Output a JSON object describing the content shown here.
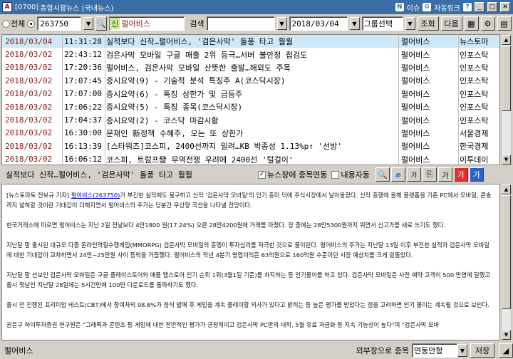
{
  "window": {
    "code": "[0700]",
    "title": "종합시황뉴스 (국내뉴스)",
    "icon_letter": "A",
    "right_items": [
      "N",
      "이슈",
      "자동링크",
      "?"
    ],
    "window_buttons": [
      "_",
      "□",
      "✕"
    ]
  },
  "toolbar": {
    "radio_all": "전체",
    "radio_single_selected": true,
    "stock_code": "263750",
    "stock_tag": "신",
    "stock_name": "펄어비스",
    "search_label": "검색",
    "search_value": "",
    "date": "2018/03/04",
    "group_select": "그룹선택",
    "btn_query": "조회",
    "btn_next": "다음",
    "icons": [
      "screen-icon",
      "gear-icon",
      "save-icon"
    ]
  },
  "news": [
    {
      "date": "2018/03/04",
      "time": "11:31:28",
      "headline": "실적보다 신작…펄어비스, '검은사막' 돌풍 타고 훨훨",
      "stock": "펄어비스",
      "source": "뉴스토마",
      "selected": true
    },
    {
      "date": "2018/03/02",
      "time": "22:43:12",
      "headline": "검은사막 모바일 구글 매출 2위 등극…서버 불안정 접검도",
      "stock": "펄어비스",
      "source": "인포스탁",
      "selected": false
    },
    {
      "date": "2018/03/02",
      "time": "17:20:36",
      "headline": "펄어비스, 검은사막 모바일 산뜻한 출발…해외도 주목",
      "stock": "펄어비스",
      "source": "인포스탁",
      "selected": false
    },
    {
      "date": "2018/03/02",
      "time": "17:07:45",
      "headline": "증시요약(9) - 기술적 분석 특징주 A(코스닥시장)",
      "stock": "펄어비스",
      "source": "인포스탁",
      "selected": false
    },
    {
      "date": "2018/03/02",
      "time": "17:07:00",
      "headline": "증시요약(6) - 특징 상한가 및 급등주",
      "stock": "펄어비스",
      "source": "인포스탁",
      "selected": false
    },
    {
      "date": "2018/03/02",
      "time": "17:06:22",
      "headline": "증시요약(5) - 특징 종목(코스닥시장)",
      "stock": "펄어비스",
      "source": "인포스탁",
      "selected": false
    },
    {
      "date": "2018/03/02",
      "time": "17:04:37",
      "headline": "증시요약(2) - 코스닥 마감시황",
      "stock": "펄어비스",
      "source": "인포스탁",
      "selected": false
    },
    {
      "date": "2018/03/02",
      "time": "16:30:00",
      "headline": "문재인 新정책 수혜주, 오는 또 상한가",
      "stock": "펄어비스",
      "source": "서울경제",
      "selected": false
    },
    {
      "date": "2018/03/02",
      "time": "16:13:39",
      "headline": "[스타워즈]코스피, 2400선까지 밀려…KB 박종성 1.13%p↑ '선방'",
      "stock": "펄어비스",
      "source": "한국경제",
      "selected": false
    },
    {
      "date": "2018/03/02",
      "time": "16:06:12",
      "headline": "코스피, 트럼프發 무역전쟁 우려에 2400선 '털걸이'",
      "stock": "펄어비스",
      "source": "이투데이",
      "selected": false
    }
  ],
  "detail": {
    "title": "실적보다 신작…펄어비스, '검은사막' 돌풍 타고 훨훨",
    "cb_popup": "뉴스창에 종목연동",
    "cb_popup_checked": true,
    "cb_content": "내용자동",
    "cb_content_checked": false,
    "tools": [
      "search-icon",
      "ie-icon",
      "font-size-icon",
      "copy-icon",
      "font-icon",
      "font-larger-icon",
      "font-smaller-icon"
    ],
    "tool_labels": [
      "🔍",
      "e",
      "가",
      "⎘",
      "가",
      "가",
      "가"
    ]
  },
  "article": {
    "p1_prefix": "[뉴스토마토 전보규 기자] ",
    "p1_link": "펄어비스(263750)",
    "p1_rest": "가 부진한 실적에도 불구하고 신작 '검은사막 모바일'의 인기 흥미 덕에 주식시장에서 날아올랐다. 신작 흥행에 올해 플랫폼을 기존 PC에서 모바일, 콘솔까지 넓혀갈 것이란 기대감이 더해지면서 펄어비스의 주가는 당분간 우상향 곡선을 나타낼 전망이다.",
    "p2": "한국거래소에 따르면 펄어비스는 지난 2일 전날보다 4만1800 원(17.24%) 오른 28만4200원에 거래를 마쳤다. 장 중에는 28만5300원까지 뛰면서 신고가를 새로 쓰기도 했다.",
    "p3": "지난달 말 출시된 대규모 다중 온라인역할수행게임(MMORPG) 검은사막 모바일의 흥행이 투자심리를 자극한 것으로 풀이된다. 펄어비스의 주가는 지난달 13일 이후 부진한 실적과 검은사막 모바일에 대한 기대감이 교차하면서 24만~25만원 사이 등락을 거듭했다. 펄어비스의 작년 4분기 영업이익은 63억원으로 160억원 수준이던 시장 예상치를 크게 밑돌았다.",
    "p4": "지난달 말 선보인 검은사막 모바일은 구글 플레이스토어와 애플 앱스토어 인기 순위 1위(3월1일 기준)를 차지하는 등 인기몰이를 하고 있다. 검은사막 모바일은 사전 예약 고객이 500 만명에 달했고 출시 첫날인 지난달 28일에는 5시간만에 100만 다운로드를 돌파하기도 했다.",
    "p5": "출시 전 진행된 프리미엄 테스트(CBT)에서 참여자의 98.8%가 정식 발매 후 게임을 계속 플레이할 의사가 있다고 밝히는 등 높은 평가를 받았다는 점을 고려하면 인기 몰이는 계속될 것으로 보인다.",
    "p6": "권윤구 하이투자증권 연구원은 \"그래픽과 콘텐츠 등 게임에 대한 전반적인 평가가 긍정적이고 검은사막 PC판의 대작, 5월 유료 과금화 등 지속 기능성이 높다\"며 \"검은사막 모바"
  },
  "bottom": {
    "stock_name": "펄어비스",
    "ext_label": "외부창으로 종목",
    "ext_select": "연동안함",
    "save_btn": "저장"
  }
}
